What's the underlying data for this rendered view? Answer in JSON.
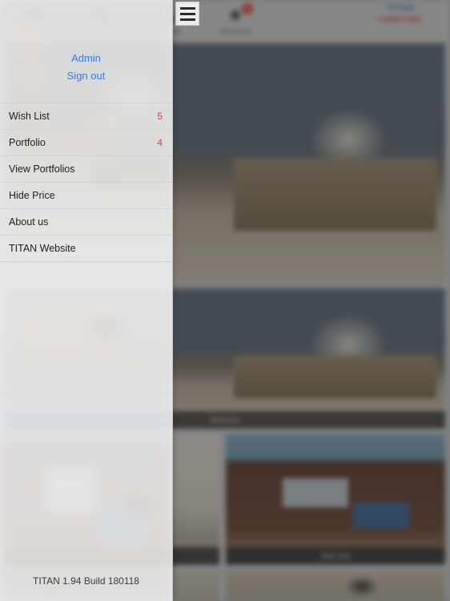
{
  "topbar": {
    "menu_button_name": "hamburger-menu",
    "items": [
      {
        "icon": "catalog-icon",
        "label": "Catalog",
        "badge": ""
      },
      {
        "icon": "search-icon",
        "label": "Search",
        "badge": ""
      },
      {
        "icon": "contact-icon",
        "label": "Contact",
        "badge": ""
      },
      {
        "icon": "shortcuts-icon",
        "label": "Shortcuts",
        "badge": "3"
      }
    ],
    "brand": {
      "top": "TITAN",
      "sub": "FURNITURE"
    }
  },
  "drawer": {
    "account": {
      "admin_label": "Admin",
      "signout_label": "Sign out"
    },
    "menu": [
      {
        "label": "Wish List",
        "count": "5"
      },
      {
        "label": "Portfolio",
        "count": "4"
      },
      {
        "label": "View Portfolios",
        "count": ""
      },
      {
        "label": "Hide Price",
        "count": ""
      },
      {
        "label": "About us",
        "count": ""
      },
      {
        "label": "TITAN Website",
        "count": ""
      }
    ],
    "version": "TITAN 1.94 Build 180118"
  },
  "gallery": {
    "items": [
      {
        "name": "bedroom-hero",
        "caption": ""
      },
      {
        "name": "bedroom-second",
        "caption": "Bedroom"
      },
      {
        "name": "chair-thumb",
        "caption": ""
      },
      {
        "name": "media-wall-thumb",
        "caption": "Wall Unit"
      },
      {
        "name": "plant-thumb",
        "caption": ""
      },
      {
        "name": "horse-thumb",
        "caption": ""
      }
    ]
  },
  "colors": {
    "link_blue": "#3a7ae0",
    "count_red": "#e0403a",
    "badge_red": "#e03b30",
    "drawer_bg": "#efefef",
    "topbar_bg": "#d9d9d9",
    "brand_blue": "#2f6fa8",
    "brand_red": "#c0392b"
  }
}
